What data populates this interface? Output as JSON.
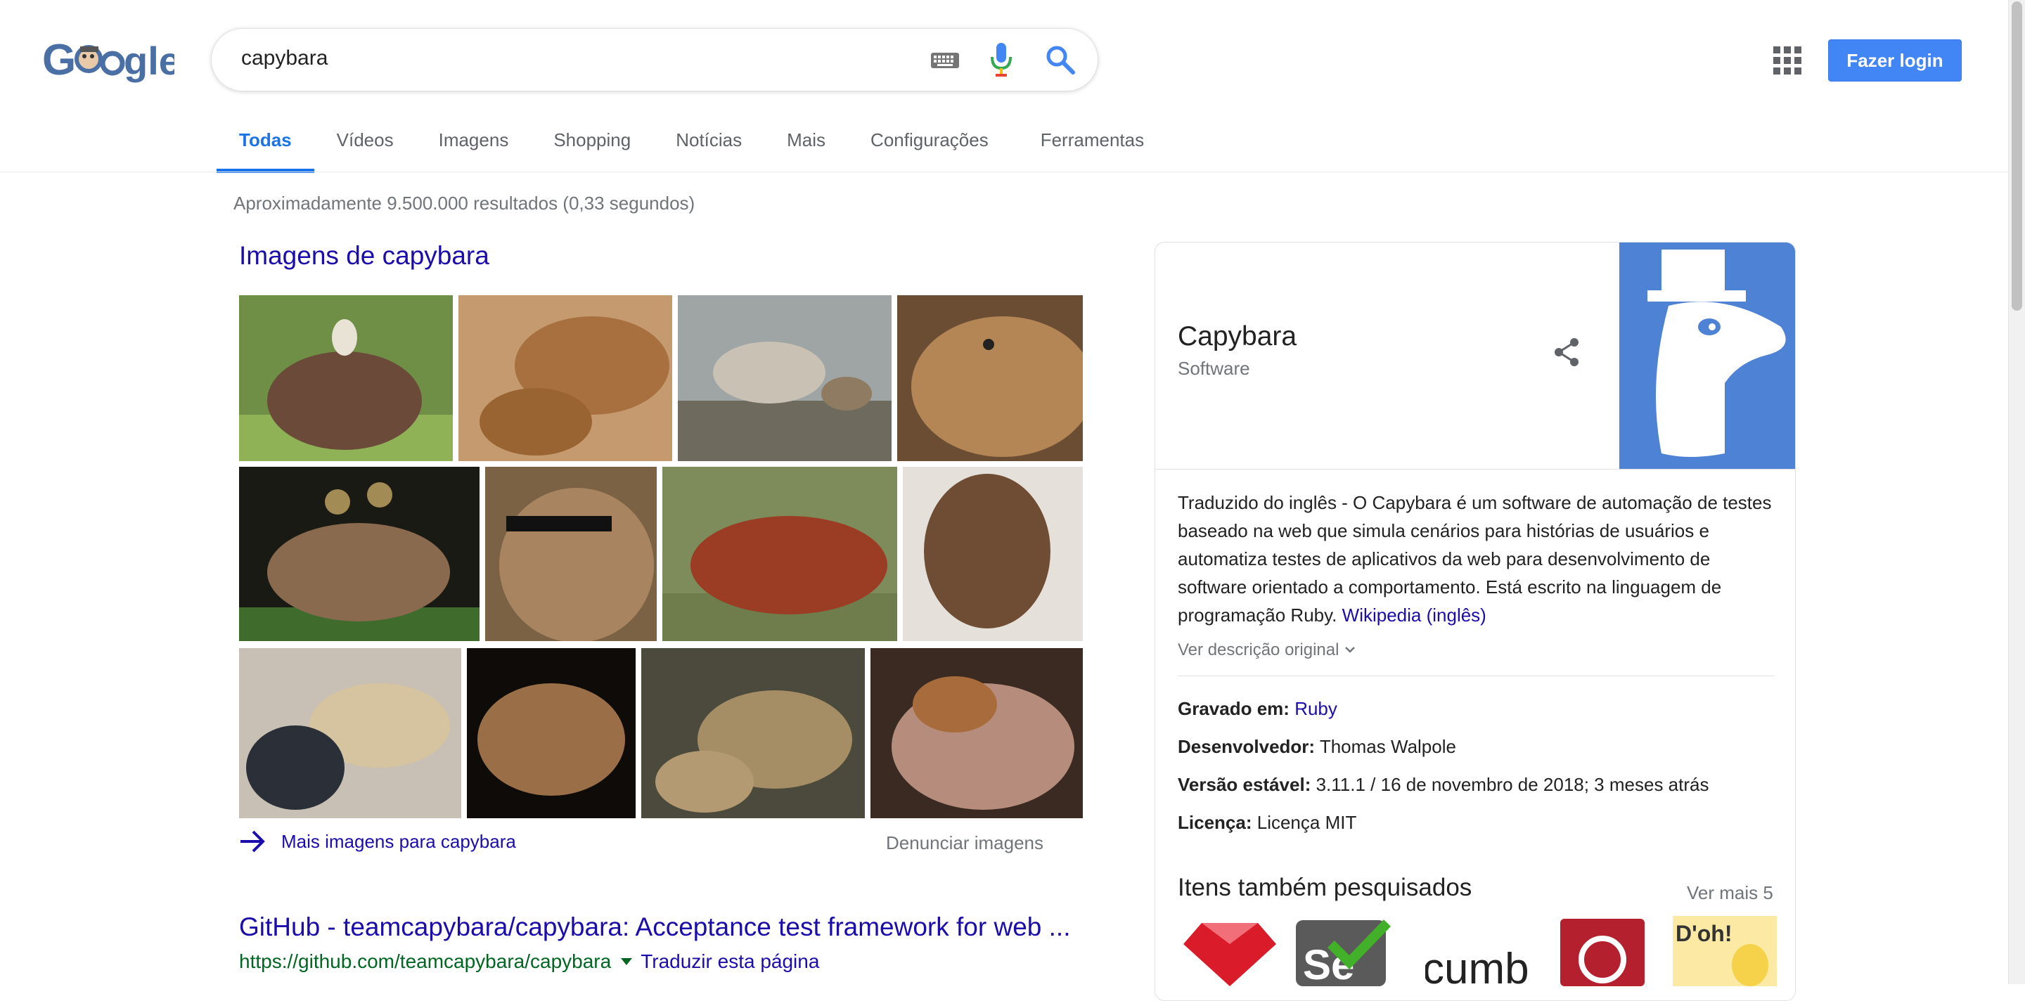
{
  "header": {
    "query": "capybara",
    "login_label": "Fazer login",
    "colors": {
      "brand_blue": "#4285f4",
      "link": "#1a0dab",
      "url_green": "#006621"
    }
  },
  "tabs": [
    {
      "label": "Todas",
      "active": true
    },
    {
      "label": "Vídeos"
    },
    {
      "label": "Imagens"
    },
    {
      "label": "Shopping"
    },
    {
      "label": "Notícias"
    },
    {
      "label": "Mais"
    },
    {
      "label": "Configurações"
    },
    {
      "label": "Ferramentas"
    }
  ],
  "results": {
    "stats": "Aproximadamente 9.500.000 resultados (0,33 segundos)",
    "images_heading": "Imagens de capybara",
    "more_images": "Mais imagens para capybara",
    "report_images": "Denunciar imagens",
    "github": {
      "title": "GitHub - teamcapybara/capybara: Acceptance test framework for web ...",
      "url": "https://github.com/teamcapybara/capybara",
      "translate": "Traduzir esta página"
    }
  },
  "knowledge_panel": {
    "title": "Capybara",
    "subtitle": "Software",
    "description": "Traduzido do inglês - O Capybara é um software de automação de testes baseado na web que simula cenários para histórias de usuários e automatiza testes de aplicativos da web para desenvolvimento de software orientado a comportamento. Está escrito na linguagem de programação Ruby.",
    "source_link": "Wikipedia (inglês)",
    "original_link": "Ver descrição original",
    "facts": [
      {
        "label": "Gravado em:",
        "value": "Ruby",
        "link": true
      },
      {
        "label": "Desenvolvedor:",
        "value": "Thomas Walpole"
      },
      {
        "label": "Versão estável:",
        "value": "3.11.1 / 16 de novembro de 2018; 3 meses atrás"
      },
      {
        "label": "Licença:",
        "value": "Licença MIT"
      }
    ],
    "also_searched_heading": "Itens também pesquisados",
    "see_more": "Ver mais 5"
  }
}
